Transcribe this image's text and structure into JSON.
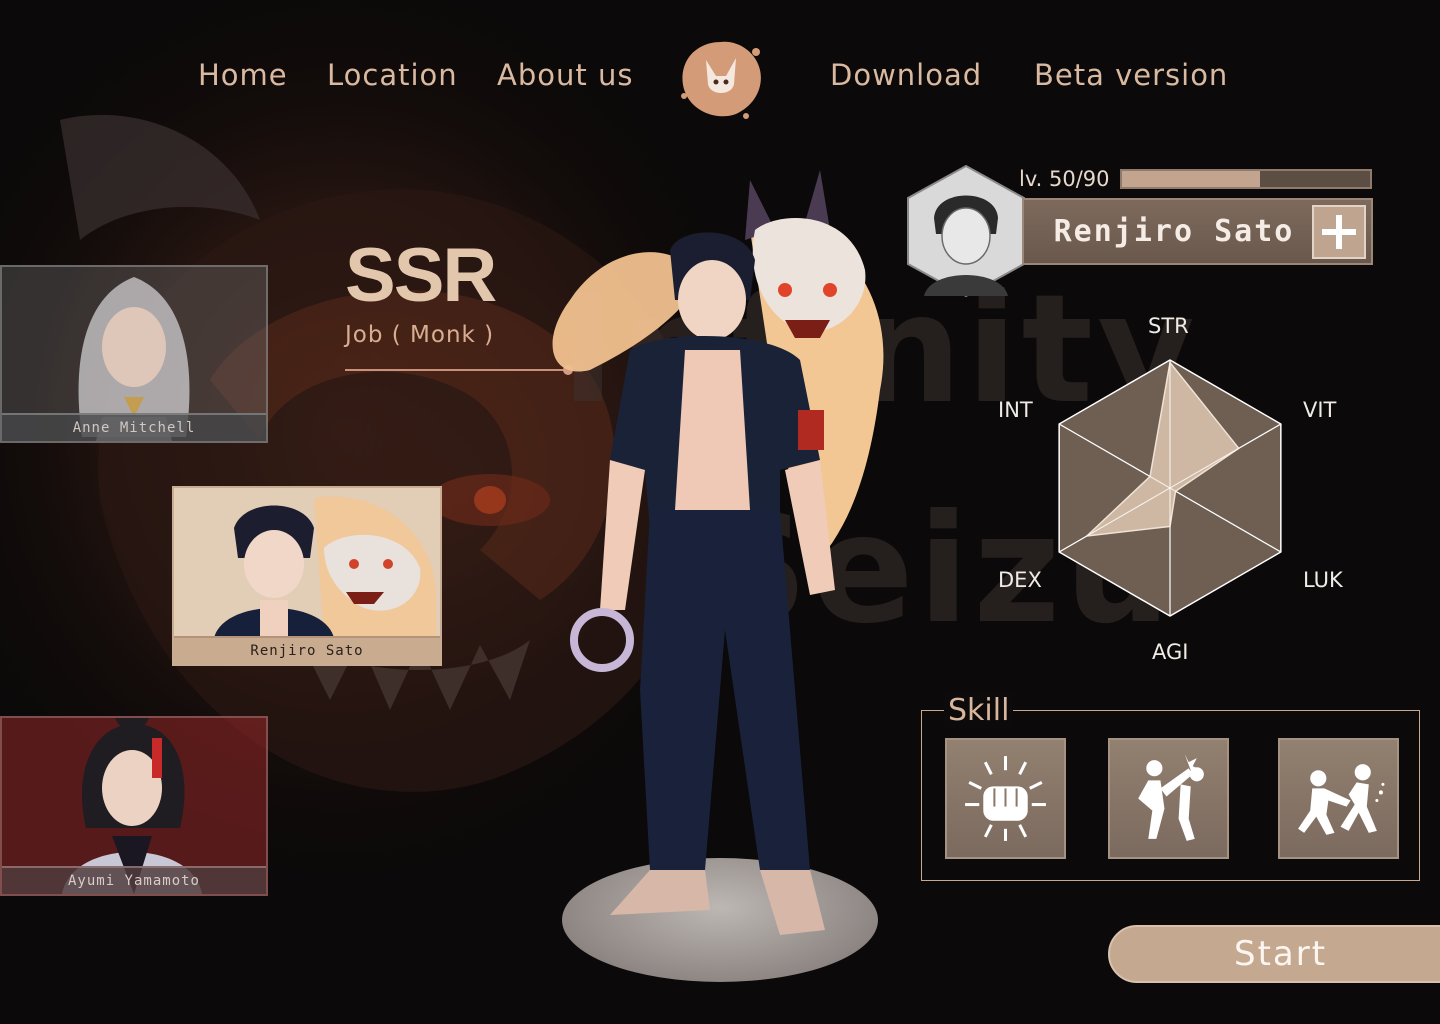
{
  "nav": {
    "items": [
      {
        "label": "Home"
      },
      {
        "label": "Location"
      },
      {
        "label": "About us"
      },
      {
        "label": "Download"
      },
      {
        "label": "Beta version"
      }
    ]
  },
  "background": {
    "watermark_line1": "Infinity",
    "watermark_line2": "Seizu"
  },
  "roster": [
    {
      "name": "Anne Mitchell"
    },
    {
      "name": "Renjiro Sato"
    },
    {
      "name": "Ayumi Yamamoto"
    }
  ],
  "character": {
    "rarity": "SSR",
    "job": "Job ( Monk )",
    "name": "Renjiro Sato",
    "level_label": "lv. 50/90",
    "level": 50,
    "level_max": 90
  },
  "stats": {
    "labels": [
      "STR",
      "VIT",
      "LUK",
      "AGI",
      "DEX",
      "INT"
    ],
    "values": [
      0.98,
      0.62,
      0.05,
      0.3,
      0.75,
      0.18
    ]
  },
  "skill": {
    "title": "Skill",
    "icons": [
      "punch-icon",
      "kick-icon",
      "combat-icon"
    ]
  },
  "start_label": "Start",
  "colors": {
    "accent": "#c5a890",
    "text": "#d9b9a0",
    "background": "#0b0909"
  }
}
